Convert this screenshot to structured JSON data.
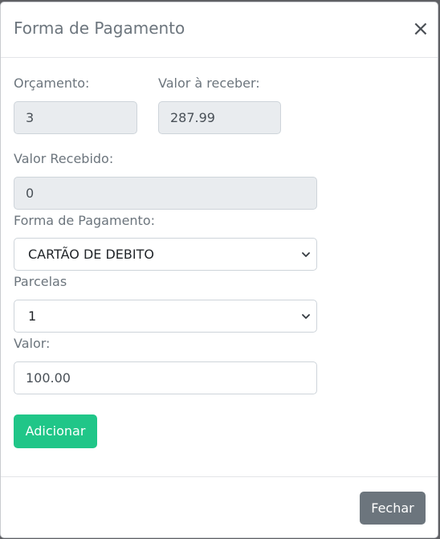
{
  "modal": {
    "title": "Forma de Pagamento",
    "close_glyph": "×"
  },
  "form": {
    "orcamento": {
      "label": "Orçamento:",
      "value": "3"
    },
    "valor_a_receber": {
      "label": "Valor à receber:",
      "value": "287.99"
    },
    "valor_recebido": {
      "label": "Valor Recebido:",
      "value": "0"
    },
    "forma_pagamento": {
      "label": "Forma de Pagamento:",
      "selected": "CARTÃO DE DEBITO"
    },
    "parcelas": {
      "label": "Parcelas",
      "selected": "1"
    },
    "valor": {
      "label": "Valor:",
      "value": "100.00"
    }
  },
  "buttons": {
    "adicionar": "Adicionar",
    "fechar": "Fechar"
  },
  "colors": {
    "primary_green": "#20c688",
    "secondary_gray": "#6c757d",
    "readonly_bg": "#e9ecef"
  }
}
